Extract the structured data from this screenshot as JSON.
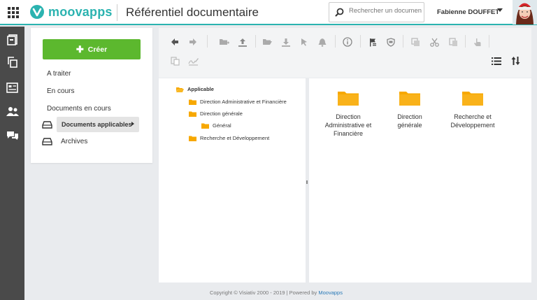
{
  "header": {
    "brand": "moovapps",
    "app_title": "Référentiel documentaire",
    "search_placeholder": "Rechercher un document",
    "user_name": "Fabienne DOUFFET",
    "accent_color": "#2bb3b0"
  },
  "rail": {
    "items": [
      "documents-icon",
      "copy-icon",
      "news-icon",
      "users-icon",
      "chat-icon"
    ]
  },
  "nav": {
    "create_label": "Créer",
    "create_color": "#5cb82e",
    "items": [
      {
        "label": "A traiter"
      },
      {
        "label": "En cours"
      },
      {
        "label": "Documents en cours"
      },
      {
        "label": "Documents applicables"
      },
      {
        "label": "Archives"
      }
    ]
  },
  "tree": {
    "root": "Applicable",
    "items": [
      {
        "label": "Direction Administrative et Financière"
      },
      {
        "label": "Direction générale"
      },
      {
        "label": "Général"
      },
      {
        "label": "Recherche et Développement"
      }
    ]
  },
  "content": {
    "folder_color": "#f7a800",
    "folders": [
      {
        "label": "Direction Administrative et Financière"
      },
      {
        "label": "Direction générale"
      },
      {
        "label": "Recherche et Développement"
      }
    ]
  },
  "footer": {
    "text": "Copyright © Visiativ 2000 - 2019 | Powered by",
    "link": "Moovapps"
  }
}
